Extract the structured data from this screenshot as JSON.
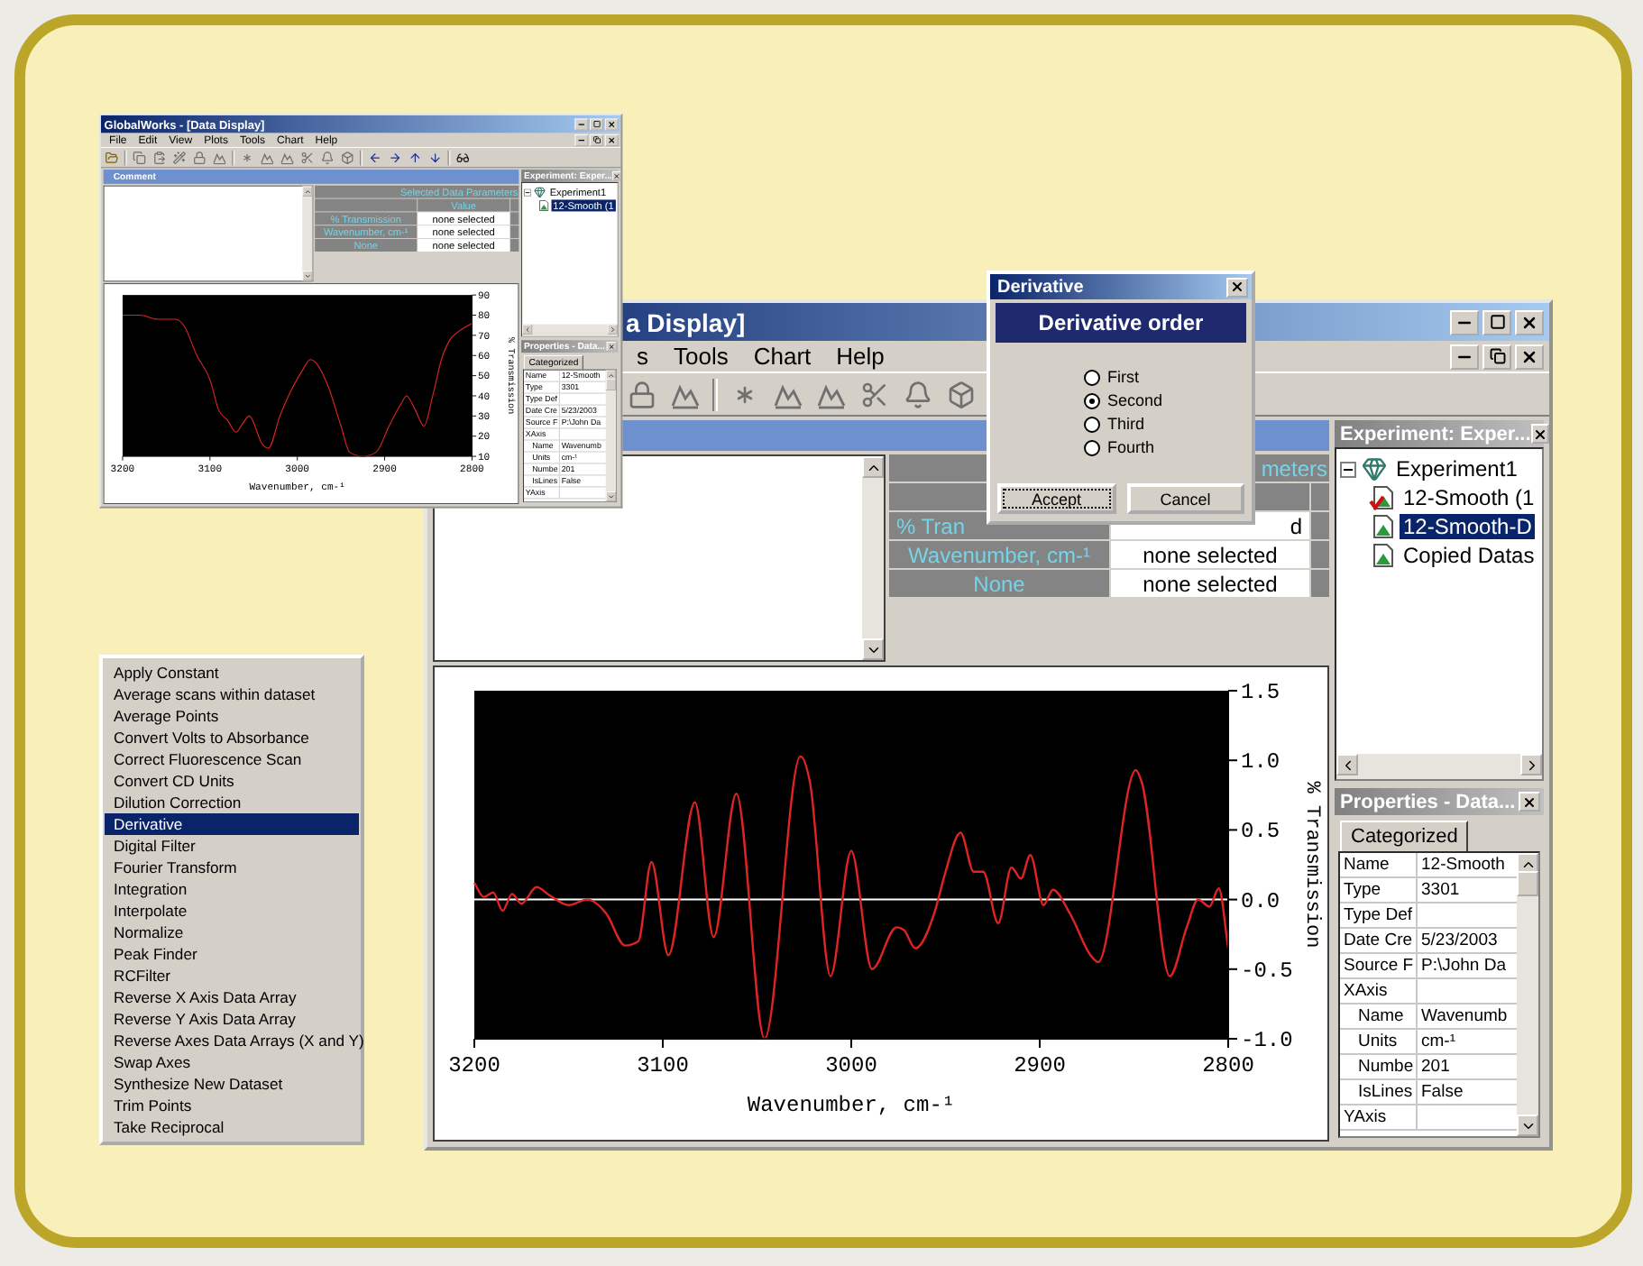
{
  "small_window": {
    "title": "GlobalWorks - [Data Display]",
    "menu": [
      "File",
      "Edit",
      "View",
      "Plots",
      "Tools",
      "Chart",
      "Help"
    ],
    "comment_label": "Comment",
    "parameters": {
      "title": "Selected Data Parameters",
      "value_header": "Value",
      "rows": [
        {
          "name": "% Transmission",
          "value": "none selected"
        },
        {
          "name": "Wavenumber, cm-¹",
          "value": "none selected"
        },
        {
          "name": "None",
          "value": "none selected"
        }
      ]
    },
    "chart_data": {
      "type": "line",
      "xlabel": "Wavenumber, cm-¹",
      "ylabel": "% Transmission",
      "x": [
        3200,
        3180,
        3160,
        3140,
        3130,
        3115,
        3100,
        3090,
        3080,
        3070,
        3063,
        3055,
        3040,
        3033,
        3020,
        3010,
        2995,
        2985,
        2978,
        2965,
        2950,
        2940,
        2925,
        2910,
        2895,
        2880,
        2875,
        2865,
        2855,
        2845,
        2835,
        2825,
        2815,
        2800
      ],
      "series": [
        {
          "color": "#e02424",
          "values": [
            80,
            80,
            78,
            78,
            75,
            60,
            48,
            33,
            28,
            22,
            26,
            30,
            16,
            14,
            30,
            40,
            52,
            58,
            56,
            45,
            25,
            12,
            10,
            12,
            25,
            37,
            40,
            33,
            25,
            40,
            58,
            68,
            72,
            76
          ]
        }
      ],
      "xlim": [
        3200,
        2800
      ],
      "ylim": [
        10,
        90
      ],
      "xticks": [
        3200,
        3100,
        3000,
        2900,
        2800
      ],
      "yticks": [
        10,
        20,
        30,
        40,
        50,
        60,
        70,
        80,
        90
      ]
    },
    "experiment_panel": {
      "title": "Experiment: Exper...",
      "tree": [
        {
          "label": "Experiment1",
          "kind": "experiment",
          "selected": false,
          "children": [
            {
              "label": "12-Smooth (1",
              "kind": "dataset",
              "selected": true
            }
          ]
        }
      ]
    },
    "properties_panel": {
      "title": "Properties - Data...",
      "tab": "Categorized",
      "rows": [
        {
          "name": "Name",
          "value": "12-Smooth"
        },
        {
          "name": "Type",
          "value": "3301"
        },
        {
          "name": "Type Def"
        },
        {
          "name": "Date Cre",
          "value": "5/23/2003"
        },
        {
          "name": "Source F",
          "value": "P:\\John Da"
        },
        {
          "name": "XAxis",
          "children": [
            {
              "name": "Name",
              "value": "Wavenumb"
            },
            {
              "name": "Units",
              "value": "cm-¹"
            },
            {
              "name": "Numbe",
              "value": "201"
            },
            {
              "name": "IsLines",
              "value": "False"
            }
          ]
        },
        {
          "name": "YAxis"
        }
      ]
    }
  },
  "main_window": {
    "title": "a Display]",
    "menu": [
      "s",
      "Tools",
      "Chart",
      "Help"
    ],
    "parameters": {
      "title": "meters",
      "rows": [
        {
          "name": "% Tran",
          "value": "d"
        },
        {
          "name": "Wavenumber, cm-¹",
          "value": "none selected"
        },
        {
          "name": "None",
          "value": "none selected"
        }
      ]
    },
    "chart_data": {
      "type": "line",
      "xlabel": "Wavenumber, cm-¹",
      "ylabel": "% Transmission",
      "x": [
        3200,
        3195,
        3190,
        3185,
        3180,
        3175,
        3167,
        3160,
        3150,
        3140,
        3130,
        3120,
        3113,
        3106,
        3097,
        3083,
        3073,
        3061,
        3046,
        3027,
        3022,
        3011,
        3000,
        2989,
        2976,
        2972,
        2966,
        2956,
        2950,
        2942,
        2935,
        2930,
        2922,
        2915,
        2910,
        2905,
        2898,
        2893,
        2884,
        2873,
        2869,
        2849,
        2846,
        2831,
        2822,
        2816,
        2810,
        2805,
        2800
      ],
      "series": [
        {
          "color": "#e02424",
          "values": [
            0.12,
            0.02,
            0.05,
            -0.08,
            0.04,
            -0.03,
            0.09,
            0.03,
            -0.04,
            0.0,
            -0.1,
            -0.33,
            -0.3,
            0.27,
            -0.4,
            0.7,
            -0.27,
            0.76,
            -1.0,
            1.03,
            0.85,
            -0.55,
            0.35,
            -0.5,
            -0.2,
            -0.22,
            -0.35,
            -0.1,
            0.2,
            0.48,
            0.2,
            0.2,
            -0.17,
            0.23,
            0.15,
            0.32,
            -0.04,
            0.07,
            -0.1,
            -0.4,
            -0.45,
            0.93,
            0.85,
            -0.55,
            -0.2,
            0.0,
            -0.05,
            0.08,
            -0.35
          ]
        }
      ],
      "xlim": [
        3200,
        2800
      ],
      "ylim": [
        -1,
        1.5
      ],
      "xticks": [
        3200,
        3100,
        3000,
        2900,
        2800
      ],
      "yticks": [
        {
          "value": -1,
          "label": "-1.0"
        },
        {
          "value": -0.5,
          "label": "-0.5"
        },
        {
          "value": 0,
          "label": "0.0"
        },
        {
          "value": 0.5,
          "label": "0.5"
        },
        {
          "value": 1,
          "label": "1.0"
        },
        {
          "value": 1.5,
          "label": "1.5"
        }
      ]
    },
    "experiment_panel": {
      "title": "Experiment: Exper...",
      "tree": [
        {
          "label": "Experiment1",
          "kind": "experiment",
          "selected": false,
          "children": [
            {
              "label": "12-Smooth (1",
              "kind": "dataset",
              "selected": false,
              "checked": true
            },
            {
              "label": "12-Smooth-D",
              "kind": "dataset",
              "selected": true,
              "checked": false
            },
            {
              "label": "Copied Datas",
              "kind": "dataset",
              "selected": false,
              "checked": false
            }
          ]
        }
      ]
    },
    "properties_panel": {
      "title": "Properties - Data...",
      "tab": "Categorized",
      "rows": [
        {
          "name": "Name",
          "value": "12-Smooth"
        },
        {
          "name": "Type",
          "value": "3301"
        },
        {
          "name": "Type Def"
        },
        {
          "name": "Date Cre",
          "value": "5/23/2003"
        },
        {
          "name": "Source F",
          "value": "P:\\John Da"
        },
        {
          "name": "XAxis",
          "children": [
            {
              "name": "Name",
              "value": "Wavenumb"
            },
            {
              "name": "Units",
              "value": "cm-¹"
            },
            {
              "name": "Numbe",
              "value": "201"
            },
            {
              "name": "IsLines",
              "value": "False"
            }
          ]
        },
        {
          "name": "YAxis"
        }
      ]
    }
  },
  "dialog": {
    "title": "Derivative",
    "heading": "Derivative order",
    "options": [
      {
        "label": "First",
        "selected": false
      },
      {
        "label": "Second",
        "selected": true
      },
      {
        "label": "Third",
        "selected": false
      },
      {
        "label": "Fourth",
        "selected": false
      }
    ],
    "buttons": [
      "Accept",
      "Cancel"
    ]
  },
  "tools_menu": {
    "items": [
      {
        "label": "Apply Constant",
        "selected": false
      },
      {
        "label": "Average scans within dataset",
        "selected": false
      },
      {
        "label": "Average Points",
        "selected": false
      },
      {
        "label": "Convert Volts to Absorbance",
        "selected": false
      },
      {
        "label": "Correct Fluorescence Scan",
        "selected": false
      },
      {
        "label": "Convert CD Units",
        "selected": false
      },
      {
        "label": "Dilution Correction",
        "selected": false
      },
      {
        "label": "Derivative",
        "selected": true
      },
      {
        "label": "Digital Filter",
        "selected": false
      },
      {
        "label": "Fourier Transform",
        "selected": false
      },
      {
        "label": "Integration",
        "selected": false
      },
      {
        "label": "Interpolate",
        "selected": false
      },
      {
        "label": "Normalize",
        "selected": false
      },
      {
        "label": "Peak Finder",
        "selected": false
      },
      {
        "label": "RCFilter",
        "selected": false
      },
      {
        "label": "Reverse X Axis Data Array",
        "selected": false
      },
      {
        "label": "Reverse Y Axis Data Array",
        "selected": false
      },
      {
        "label": "Reverse Axes Data Arrays (X and Y)",
        "selected": false
      },
      {
        "label": "Swap Axes",
        "selected": false
      },
      {
        "label": "Synthesize New Dataset",
        "selected": false
      },
      {
        "label": "Trim Points",
        "selected": false
      },
      {
        "label": "Take Reciprocal",
        "selected": false
      }
    ]
  }
}
